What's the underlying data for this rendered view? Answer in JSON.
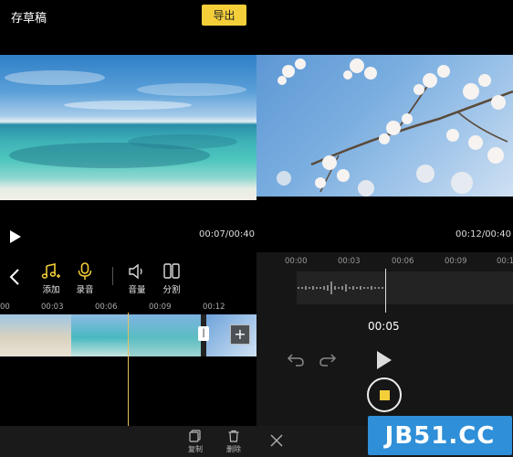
{
  "left_panel": {
    "header": {
      "title": "存草稿",
      "export_label": "导出"
    },
    "player": {
      "time": "00:07/00:40"
    },
    "toolbar": {
      "items": [
        {
          "label": "添加",
          "icon": "music-add-icon"
        },
        {
          "label": "录音",
          "icon": "microphone-icon"
        },
        {
          "label": "音量",
          "icon": "speaker-icon"
        },
        {
          "label": "分割",
          "icon": "split-icon"
        }
      ]
    },
    "ruler_ticks": [
      "00",
      "00:03",
      "00:06",
      "00:09",
      "00:12"
    ],
    "timeline": {
      "add_label": "+",
      "handle_label": "|"
    },
    "actions": [
      {
        "label": "复制",
        "icon": "copy-icon"
      },
      {
        "label": "删除",
        "icon": "trash-icon"
      }
    ]
  },
  "right_panel": {
    "player": {
      "time": "00:12/00:40"
    },
    "ruler_ticks": [
      "00:00",
      "00:03",
      "00:06",
      "00:09",
      "00:1"
    ],
    "recording_time": "00:05"
  },
  "watermark": {
    "text": "JB51.CC"
  },
  "colors": {
    "accent": "#f4cf3a",
    "watermark_bg": "#2f8fd8"
  }
}
